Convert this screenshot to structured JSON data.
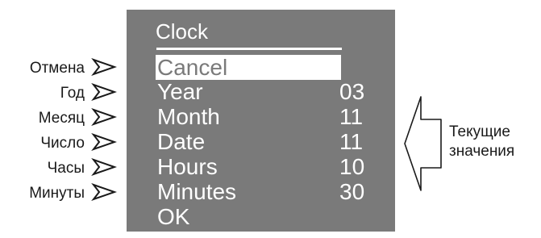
{
  "screen": {
    "title": "Clock",
    "items": [
      {
        "label": "Cancel",
        "value": "",
        "selected": true
      },
      {
        "label": "Year",
        "value": "03",
        "selected": false
      },
      {
        "label": "Month",
        "value": "11",
        "selected": false
      },
      {
        "label": "Date",
        "value": "11",
        "selected": false
      },
      {
        "label": "Hours",
        "value": "10",
        "selected": false
      },
      {
        "label": "Minutes",
        "value": "30",
        "selected": false
      },
      {
        "label": "OK",
        "value": "",
        "selected": false
      }
    ],
    "background_color": "#7a7a7a",
    "text_color": "#ffffff"
  },
  "left_labels": [
    "Отмена",
    "Год",
    "Месяц",
    "Число",
    "Часы",
    "Минуты"
  ],
  "right_label": {
    "line1": "Текущие",
    "line2": "значения"
  }
}
